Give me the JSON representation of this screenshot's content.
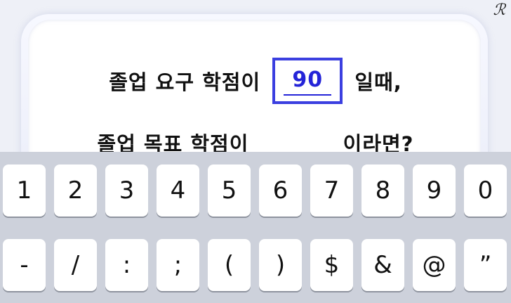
{
  "logo": "ℛ",
  "question": {
    "line1_prefix": "졸업 요구 학점이",
    "line1_suffix": "일때,",
    "line2_prefix": "졸업 목표 학점이",
    "line2_suffix": "이라면?",
    "answer_value": "90"
  },
  "keyboard": {
    "row1": [
      "1",
      "2",
      "3",
      "4",
      "5",
      "6",
      "7",
      "8",
      "9",
      "0"
    ],
    "row2": [
      "-",
      "/",
      ":",
      ";",
      "(",
      ")",
      "$",
      "&",
      "@",
      "”"
    ]
  }
}
